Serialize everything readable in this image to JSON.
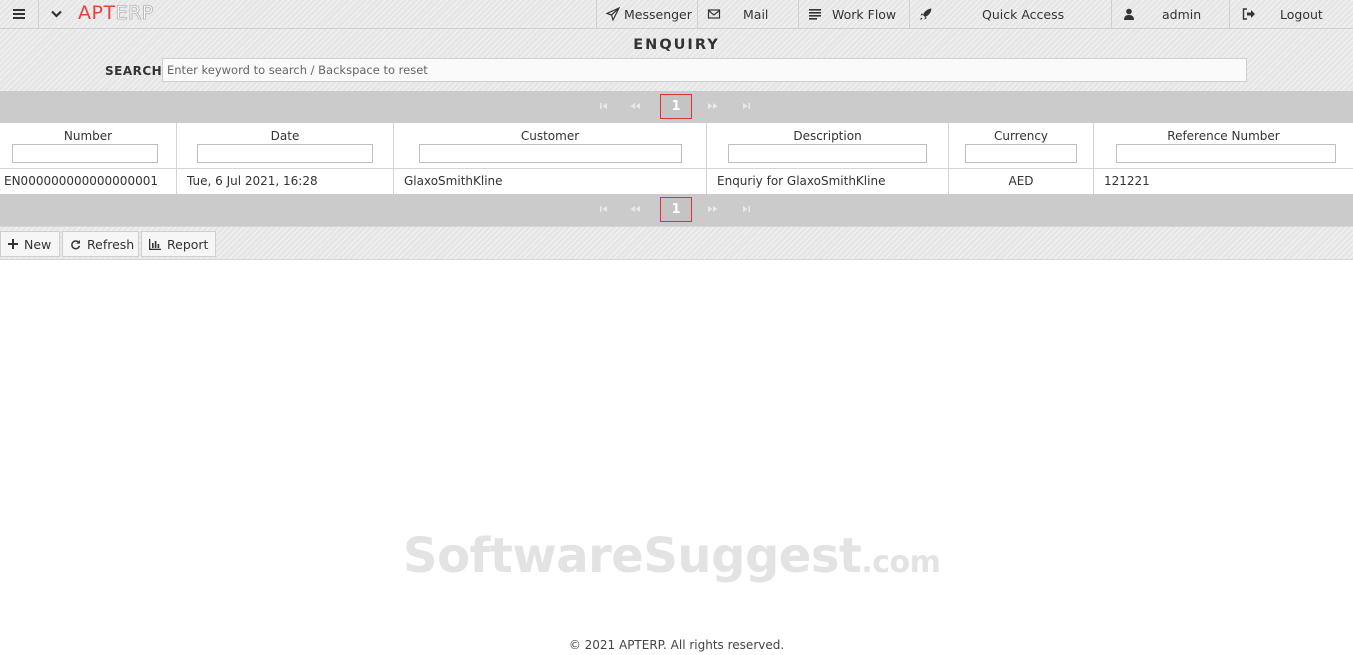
{
  "app": {
    "logo_left": "APT",
    "logo_right": "ERP"
  },
  "topnav": [
    {
      "label": "Messenger",
      "icon": "paper-plane-icon"
    },
    {
      "label": "Mail",
      "icon": "envelope-icon"
    },
    {
      "label": "Work Flow",
      "icon": "list-icon"
    },
    {
      "label": "Quick Access",
      "icon": "rocket-icon"
    },
    {
      "label": "admin",
      "icon": "user-icon"
    },
    {
      "label": "Logout",
      "icon": "sign-out-icon"
    }
  ],
  "page": {
    "title": "ENQUIRY",
    "search_label": "SEARCH:",
    "search_placeholder": "Enter keyword to search / Backspace to reset"
  },
  "pager": {
    "current": "1"
  },
  "table": {
    "columns": [
      "Number",
      "Date",
      "Customer",
      "Description",
      "Currency",
      "Reference Number"
    ],
    "rows": [
      [
        "EN000000000000000001",
        "Tue, 6 Jul 2021, 16:28",
        "GlaxoSmithKline",
        "Enquriy for GlaxoSmithKline",
        "AED",
        "121221"
      ]
    ]
  },
  "toolbar": {
    "new_label": "New",
    "refresh_label": "Refresh",
    "report_label": "Report"
  },
  "watermark": {
    "main": "SoftwareSuggest",
    "suffix": ".com"
  },
  "footer": {
    "text": "© 2021 APTERP. All rights reserved."
  },
  "colors": {
    "accent": "#e8413c",
    "pager_bg": "#cbcbcb",
    "current_page_border": "#dd3333"
  }
}
